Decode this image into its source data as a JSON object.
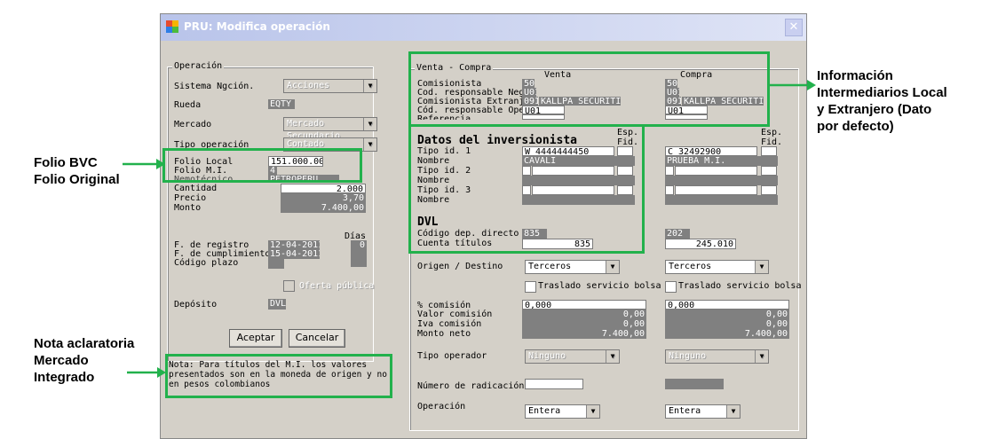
{
  "window": {
    "title": "PRU: Modifica operación",
    "close": "✕"
  },
  "operacion": {
    "legend": "Operación",
    "sistema_label": "Sistema Ngción.",
    "sistema_value": "Acciones",
    "rueda_label": "Rueda",
    "rueda_value": "EQTY",
    "mercado_label": "Mercado",
    "mercado_value": "Mercado Secundario",
    "tipo_label": "Tipo operación",
    "tipo_value": "Contado",
    "folio_local_label": "Folio Local",
    "folio_local_value": "151.000.004",
    "folio_mi_label": "Folio M.I.",
    "folio_mi_value": "4",
    "nemotecnico_label": "Nemotécnico",
    "nemotecnico_value": "PETROPERU",
    "cantidad_label": "Cantidad",
    "cantidad_value": "2.000",
    "precio_label": "Precio",
    "precio_value": "3,70",
    "monto_label": "Monto",
    "monto_value": "7.400,00",
    "dias_label": "Días",
    "f_registro_label": "F. de registro",
    "f_registro_value": "12-04-2011",
    "dias_value": "0",
    "f_cumplimiento_label": "F. de cumplimiento",
    "f_cumplimiento_value": "15-04-2011",
    "codigo_plazo_label": "Código plazo",
    "oferta_publica_label": "Oferta pública",
    "deposito_label": "Depósito",
    "deposito_value": "DVL"
  },
  "buttons": {
    "aceptar": "Aceptar",
    "cancelar": "Cancelar"
  },
  "nota": "Nota: Para títulos del M.I. los valores presentados son en la moneda de origen y no en pesos colombianos",
  "venta_compra": {
    "legend": "Venta - Compra",
    "venta_header": "Venta",
    "compra_header": "Compra",
    "comisionista_label": "Comisionista",
    "venta_comisionista": "50",
    "compra_comisionista": "50",
    "cod_resp_neg_label": "Cod. responsable Neg",
    "venta_cod_neg": "U01",
    "compra_cod_neg": "U01",
    "comisionista_extranj_label": "Comisionista Extranj",
    "venta_extranj_code": "091",
    "venta_extranj_name": "KALLPA SECURITI",
    "compra_extranj_code": "091",
    "compra_extranj_name": "KALLPA SECURITI",
    "cod_resp_ope_label": "Cód. responsable Ope",
    "venta_cod_ope": "U01",
    "compra_cod_ope": "U01",
    "referencia_label": "Referencia",
    "esp_fid_label": "Esp. Fid.",
    "datos_title": "Datos del inversionista",
    "tipo_id1_label": "Tipo id. 1",
    "venta_tipo_id1": "W 4444444450",
    "compra_tipo_id1": "C 32492900",
    "nombre_label": "Nombre",
    "venta_nombre1": "CAVALI",
    "compra_nombre1": "PRUEBA M.I.",
    "tipo_id2_label": "Tipo id. 2",
    "tipo_id3_label": "Tipo id. 3",
    "dvl_title": "DVL",
    "codigo_dep_label": "Código dep. directo",
    "venta_codigo_dep": "835",
    "compra_codigo_dep": "202",
    "cuenta_titulos_label": "Cuenta títulos",
    "venta_cuenta": "835",
    "compra_cuenta": "245.010",
    "origen_label": "Origen / Destino",
    "venta_origen": "Terceros",
    "compra_origen": "Terceros",
    "traslado_label": "Traslado servicio bolsa",
    "pct_comision_label": "% comisión",
    "venta_pct": "0,000",
    "compra_pct": "0,000",
    "valor_comision_label": "Valor comisión",
    "venta_valor_comision": "0,00",
    "compra_valor_comision": "0,00",
    "iva_label": "Iva comisión",
    "venta_iva": "0,00",
    "compra_iva": "0,00",
    "monto_neto_label": "Monto neto",
    "venta_monto_neto": "7.400,00",
    "compra_monto_neto": "7.400,00",
    "tipo_operador_label": "Tipo operador",
    "venta_tipo_operador": "Ninguno",
    "compra_tipo_operador": "Ninguno",
    "radicacion_label": "Número de radicación",
    "operacion_label": "Operación",
    "venta_operacion": "Entera",
    "compra_operacion": "Entera"
  },
  "annotations": {
    "folio": "Folio BVC\nFolio Original",
    "info": "Información\nIntermediarios Local\ny Extranjero (Dato\npor defecto)",
    "nota": "Nota aclaratoria\nMercado\nIntegrado"
  },
  "colors": {
    "highlight": "#22b14c",
    "window_bg": "#d4d0c8",
    "field_dark": "#808080"
  }
}
